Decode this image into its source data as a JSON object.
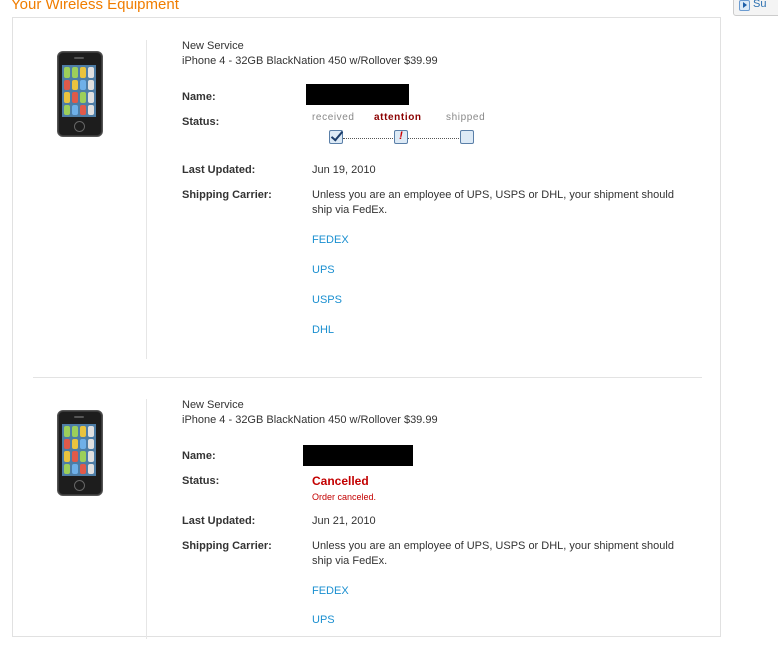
{
  "page": {
    "heading": "Your Wireless Equipment",
    "corner_button_label": "Su"
  },
  "orders": [
    {
      "service_type": "New Service",
      "plan": "iPhone 4 - 32GB BlackNation 450 w/Rollover $39.99",
      "name_label": "Name:",
      "status_label": "Status:",
      "status_steps": [
        "received",
        "attention",
        "shipped"
      ],
      "status_active_step": "attention",
      "last_updated_label": "Last Updated:",
      "last_updated": "Jun 19, 2010",
      "shipping_label": "Shipping Carrier:",
      "shipping_text": "Unless you are an employee of UPS, USPS or DHL, your shipment should ship via FedEx.",
      "carriers": [
        "FEDEX",
        "UPS",
        "USPS",
        "DHL"
      ]
    },
    {
      "service_type": "New Service",
      "plan": "iPhone 4 - 32GB BlackNation 450 w/Rollover $39.99",
      "name_label": "Name:",
      "status_label": "Status:",
      "status_text": "Cancelled",
      "status_note": "Order canceled.",
      "last_updated_label": "Last Updated:",
      "last_updated": "Jun 21, 2010",
      "shipping_label": "Shipping Carrier:",
      "shipping_text": "Unless you are an employee of UPS, USPS or DHL, your shipment should ship via FedEx.",
      "carriers": [
        "FEDEX",
        "UPS"
      ]
    }
  ],
  "colors": {
    "heading": "#f07d00",
    "link": "#1a8fd0",
    "cancelled": "#c30000",
    "attention": "#8b0000"
  }
}
